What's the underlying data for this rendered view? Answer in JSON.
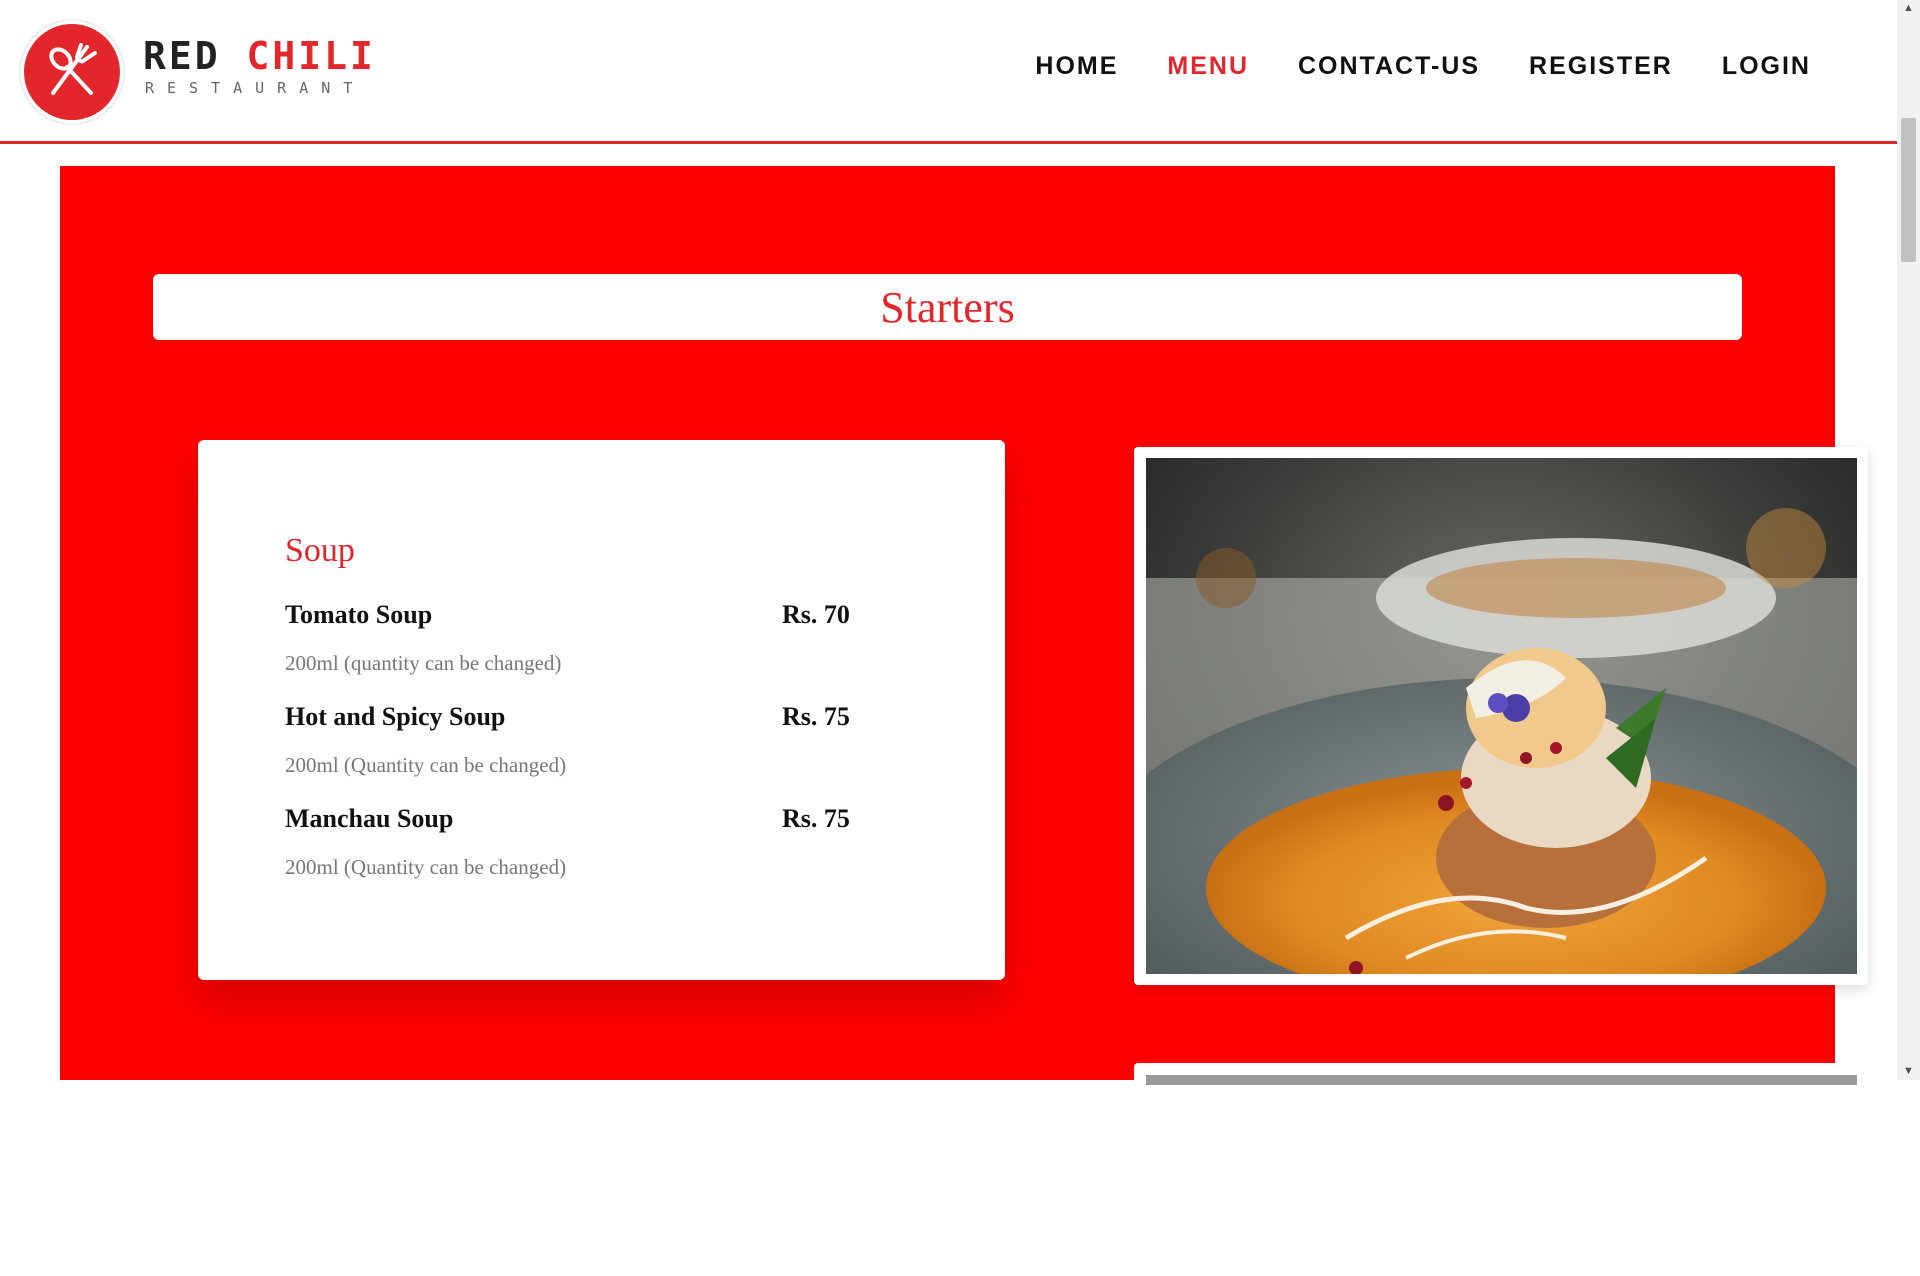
{
  "brand": {
    "name_part1": "RED ",
    "name_part2": "CHILI",
    "subtitle": "RESTAURANT",
    "logo_icon": "fork-spoon-icon",
    "accent_color": "#e3262b"
  },
  "nav": {
    "items": [
      {
        "label": "HOME",
        "active": false
      },
      {
        "label": "MENU",
        "active": true
      },
      {
        "label": "CONTACT-US",
        "active": false
      },
      {
        "label": "REGISTER",
        "active": false
      },
      {
        "label": "LOGIN",
        "active": false
      }
    ]
  },
  "section": {
    "title": "Starters",
    "background_color": "#ff0000"
  },
  "menu_card": {
    "category": "Soup",
    "items": [
      {
        "name": "Tomato Soup",
        "price": "Rs. 70",
        "description": "200ml (quantity can be changed)"
      },
      {
        "name": "Hot and Spicy Soup",
        "price": "Rs. 75",
        "description": "200ml (Quantity can be changed)"
      },
      {
        "name": "Manchau Soup",
        "price": "Rs. 75",
        "description": "200ml (Quantity can be changed)"
      }
    ]
  },
  "image": {
    "subject": "food-photo"
  }
}
